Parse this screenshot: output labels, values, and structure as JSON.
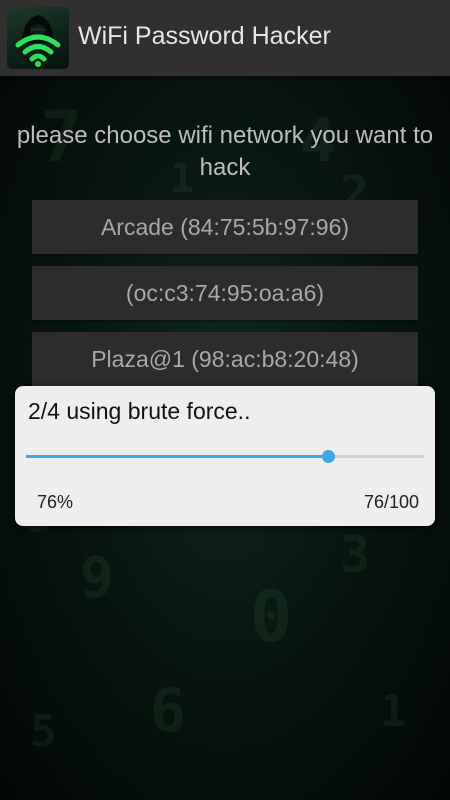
{
  "app_bar": {
    "title": "WiFi Password Hacker",
    "icon": "hacker-wifi-icon"
  },
  "main": {
    "prompt": "please choose wifi network you want to hack",
    "networks": [
      {
        "label": "Arcade (84:75:5b:97:96)"
      },
      {
        "label": "(oc:c3:74:95:oa:a6)"
      },
      {
        "label": "Plaza@1 (98:ac:b8:20:48)"
      }
    ]
  },
  "progress_dialog": {
    "message": "2/4 using brute force..",
    "percent_label": "76%",
    "count_label": "76/100",
    "progress": 0.76
  },
  "colors": {
    "app_bar": "#303030",
    "accent": "#3ea7e6",
    "background_tint": "#0b1510"
  }
}
